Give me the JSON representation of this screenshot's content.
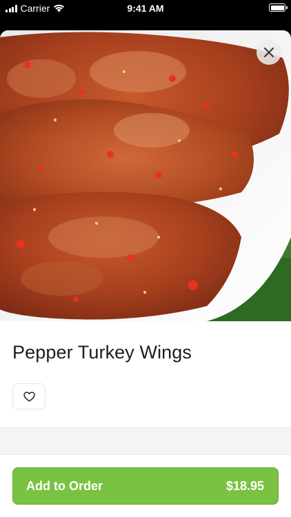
{
  "status_bar": {
    "carrier": "Carrier",
    "time": "9:41 AM"
  },
  "item": {
    "name": "Pepper Turkey Wings",
    "image_alt": "Pepper Turkey Wings"
  },
  "actions": {
    "add_label": "Add to Order",
    "price": "$18.95"
  },
  "icons": {
    "close": "close-icon",
    "favorite": "heart-icon",
    "wifi": "wifi-icon",
    "battery": "battery-icon",
    "signal": "signal-icon"
  },
  "colors": {
    "accent": "#7ac242",
    "title": "#1c1c1e"
  }
}
